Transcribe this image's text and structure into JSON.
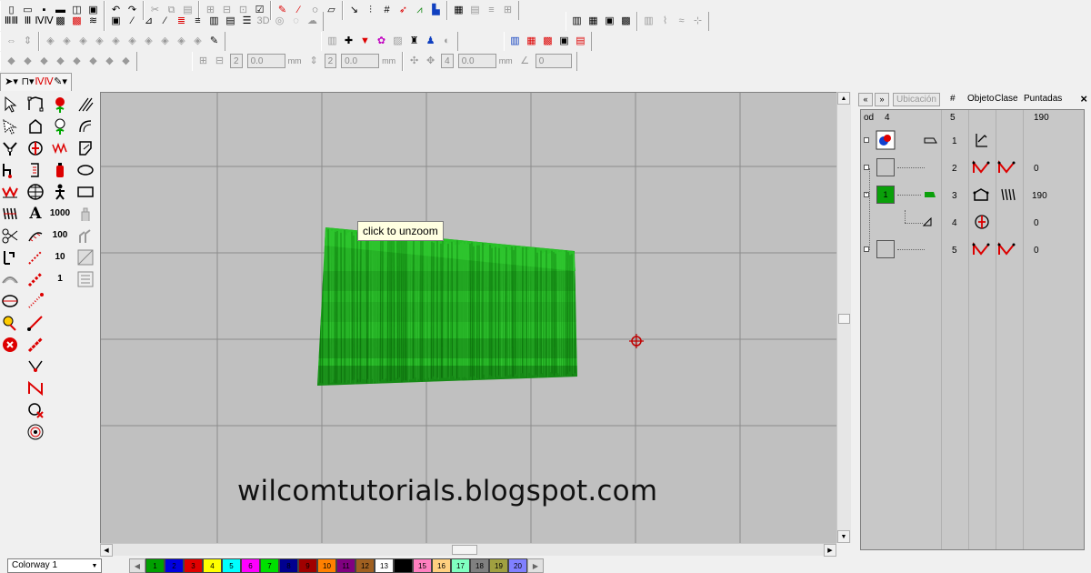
{
  "toolbar": {
    "title_3d": "3D",
    "row4_values": {
      "a_count": "2",
      "a_val": "0.0",
      "a_unit": "mm",
      "b_count": "2",
      "b_val": "0.0",
      "b_unit": "mm",
      "c_count": "4",
      "c_val": "0.0",
      "c_unit": "mm",
      "d_val": "0"
    }
  },
  "toolbox": {
    "label_1000": "1000",
    "label_100": "100",
    "label_10": "10",
    "label_1": "1",
    "label_text": "A"
  },
  "canvas": {
    "tooltip": "click to unzoom",
    "watermark": "wilcomtutorials.blogspot.com"
  },
  "panel": {
    "btn_expand": "»",
    "btn_collapse": "«",
    "location_button": "Ubicación",
    "col_hash": "#",
    "col_object": "Objeto",
    "col_class": "Clase",
    "col_stitches": "Puntadas",
    "close": "×",
    "summary": {
      "od": "od",
      "count": "4",
      "num": "5",
      "stitches": "190"
    },
    "rows": [
      {
        "num": "1",
        "stitches": ""
      },
      {
        "num": "2",
        "stitches": "0"
      },
      {
        "num": "3",
        "stitches": "190",
        "color_label": "1"
      },
      {
        "num": "4",
        "stitches": "0"
      },
      {
        "num": "5",
        "stitches": "0"
      }
    ]
  },
  "statusbar": {
    "colorway": "Colorway 1",
    "palette": [
      {
        "n": "1",
        "color": "#00a000"
      },
      {
        "n": "2",
        "color": "#0000e0"
      },
      {
        "n": "3",
        "color": "#e00000"
      },
      {
        "n": "4",
        "color": "#ffff00"
      },
      {
        "n": "5",
        "color": "#00ffff"
      },
      {
        "n": "6",
        "color": "#ff00ff"
      },
      {
        "n": "7",
        "color": "#00e000"
      },
      {
        "n": "8",
        "color": "#000090"
      },
      {
        "n": "9",
        "color": "#a00000"
      },
      {
        "n": "10",
        "color": "#ff8000"
      },
      {
        "n": "11",
        "color": "#800080"
      },
      {
        "n": "12",
        "color": "#a06020"
      },
      {
        "n": "13",
        "color": "#ffffff"
      },
      {
        "n": "14",
        "color": "#000000"
      },
      {
        "n": "15",
        "color": "#ff80c0"
      },
      {
        "n": "16",
        "color": "#ffd080"
      },
      {
        "n": "17",
        "color": "#80ffc0"
      },
      {
        "n": "18",
        "color": "#808080"
      },
      {
        "n": "19",
        "color": "#a0a040"
      },
      {
        "n": "20",
        "color": "#8080ff"
      }
    ]
  },
  "colors": {
    "canvas_bg": "#c0c0c0",
    "grid_line": "#8c8c8c",
    "stitch_green": "#1faa1f",
    "stitch_dark": "#0c6e0c",
    "accent_red": "#d00000"
  }
}
